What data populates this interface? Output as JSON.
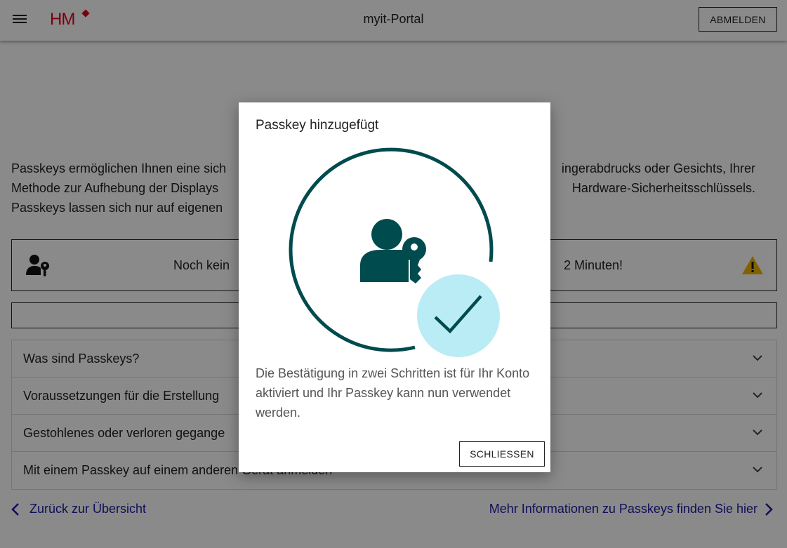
{
  "header": {
    "title": "myit-Portal",
    "logo_text": "HM",
    "logout_label": "ABMELDEN"
  },
  "intro": {
    "line1_left": "Passkeys ermöglichen Ihnen eine sich",
    "line1_right": "ingerabdrucks oder Gesichts, Ihrer",
    "line2_left": "Methode zur Aufhebung der Displays",
    "line2_right": "Hardware-Sicherheitsschlüssels.",
    "line3_left": "Passkeys lassen sich nur auf eigenen"
  },
  "status": {
    "left_text": "Noch kein",
    "right_text": "2 Minuten!"
  },
  "accordion": [
    {
      "label": "Was sind Passkeys?"
    },
    {
      "label": "Voraussetzungen für die Erstellung"
    },
    {
      "label": "Gestohlenes oder verloren gegange"
    },
    {
      "label": "Mit einem Passkey auf einem anderen Gerät anmelden"
    }
  ],
  "links": {
    "back": "Zurück zur Übersicht",
    "more": "Mehr Informationen zu Passkeys finden Sie hier"
  },
  "dialog": {
    "title": "Passkey hinzugefügt",
    "text": "Die Bestätigung in zwei Schritten ist für Ihr Konto aktiviert und Ihr Passkey kann nun verwendet werden.",
    "close_label": "SCHLIESSEN"
  },
  "colors": {
    "accent_dark": "#004b4d",
    "accent_light": "#b9ecf4",
    "brand_red": "#e2001a",
    "link_blue": "#1a1aa6",
    "warning": "#f0b400"
  },
  "icons": [
    "menu-icon",
    "user-key-icon",
    "warning-icon",
    "chevron-down-icon",
    "chevron-left-icon",
    "chevron-right-icon",
    "checkmark-icon"
  ]
}
